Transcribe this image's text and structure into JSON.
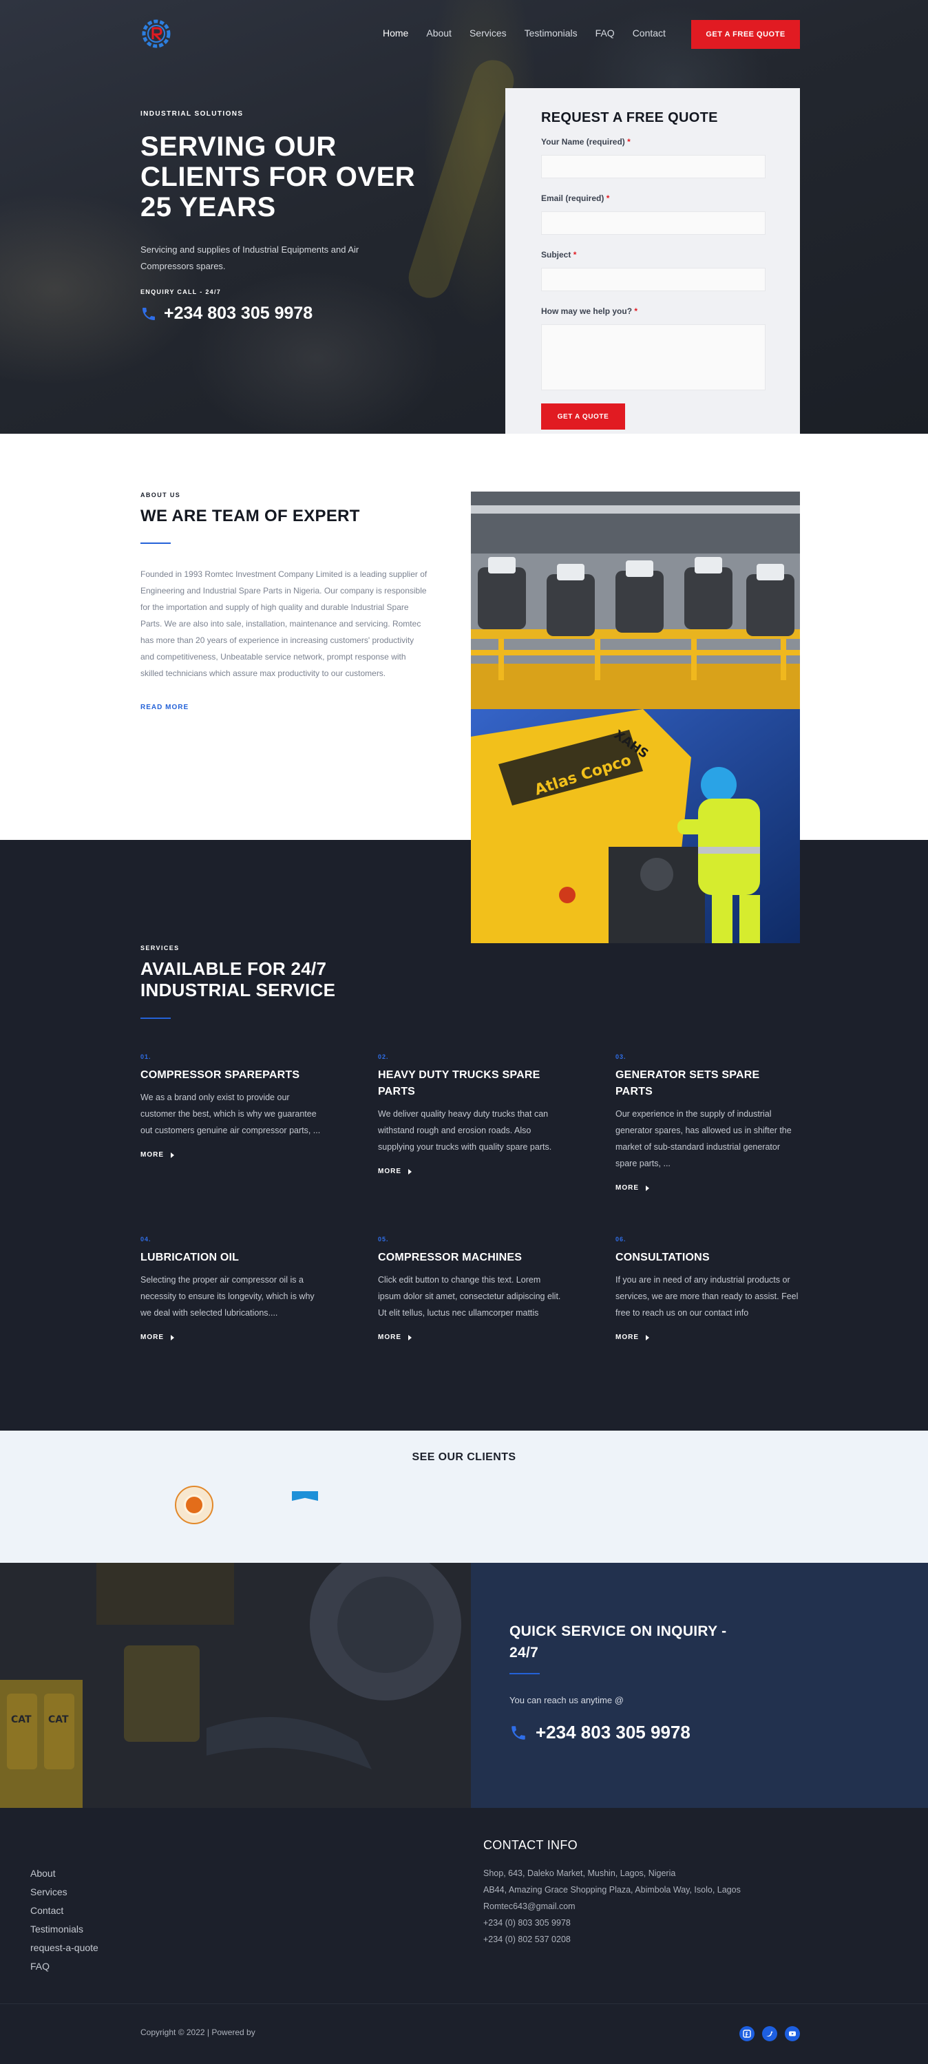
{
  "nav": {
    "items": [
      "Home",
      "About",
      "Services",
      "Testimonials",
      "FAQ",
      "Contact"
    ],
    "cta": "GET A FREE QUOTE"
  },
  "hero": {
    "eyebrow": "INDUSTRIAL SOLUTIONS",
    "title": "SERVING OUR CLIENTS FOR OVER 25 YEARS",
    "desc": "Servicing and supplies of Industrial Equipments and Air Compressors spares.",
    "enquiry_label": "ENQUIRY CALL - 24/7",
    "phone": "+234 803 305 9978"
  },
  "quote_form": {
    "title": "REQUEST A FREE QUOTE",
    "name_label": "Your Name (required)",
    "email_label": "Email (required)",
    "subject_label": "Subject",
    "message_label": "How may we help you?",
    "required_mark": "*",
    "submit": "GET A QUOTE"
  },
  "about": {
    "eyebrow": "ABOUT US",
    "title": "WE ARE TEAM OF EXPERT",
    "body": "Founded in 1993 Romtec Investment Company Limited is a leading supplier of Engineering and Industrial Spare Parts in Nigeria. Our company is responsible for the importation and supply of high quality and durable Industrial Spare Parts. We are also into sale, installation, maintenance and servicing.  Romtec has more than 20 years of experience in  increasing customers' productivity and competitiveness, Unbeatable service network, prompt response with skilled technicians which assure max productivity to our customers.",
    "read_more": "READ MORE",
    "image_text_1": "Atlas Copco",
    "image_text_2": "XAHS"
  },
  "services": {
    "eyebrow": "SERVICES",
    "title": "AVAILABLE FOR 24/7 INDUSTRIAL SERVICE",
    "more_label": "MORE",
    "items": [
      {
        "num": "01.",
        "title": "COMPRESSOR SPAREPARTS",
        "text": "We as a brand only exist to provide our customer the best, which is why we guarantee out customers genuine air compressor parts, ..."
      },
      {
        "num": "02.",
        "title": "HEAVY DUTY TRUCKS SPARE PARTS",
        "text": "We deliver quality heavy duty trucks that can withstand rough and erosion roads. Also supplying your trucks with quality spare parts."
      },
      {
        "num": "03.",
        "title": "GENERATOR SETS SPARE PARTS",
        "text": "Our experience in the supply of industrial generator spares, has allowed us in shifter the market of sub-standard industrial generator spare parts, ..."
      },
      {
        "num": "04.",
        "title": "LUBRICATION OIL",
        "text": "Selecting the proper air compressor oil is a necessity to ensure its longevity, which is why we deal with selected lubrications...."
      },
      {
        "num": "05.",
        "title": "COMPRESSOR MACHINES",
        "text": "Click edit button to change this text. Lorem ipsum dolor sit amet, consectetur adipiscing elit. Ut elit tellus, luctus nec ullamcorper mattis"
      },
      {
        "num": "06.",
        "title": "CONSULTATIONS",
        "text": "If you are in need of any industrial products or services, we are more than ready to assist. Feel free to reach us on our contact info"
      }
    ]
  },
  "clients": {
    "title": "SEE OUR CLIENTS"
  },
  "inquiry": {
    "title": "QUICK SERVICE ON INQUIRY - 24/7",
    "text": "You can reach us anytime @",
    "phone": "+234 803 305 9978",
    "image_text": "CAT"
  },
  "footer": {
    "links": [
      "About",
      "Services",
      "Contact",
      "Testimonials",
      "request-a-quote",
      "FAQ"
    ],
    "contact_title": "CONTACT INFO",
    "contact_lines": [
      "Shop, 643, Daleko Market, Mushin, Lagos, Nigeria",
      "AB44, Amazing Grace Shopping Plaza, Abimbola Way, Isolo, Lagos",
      "Romtec643@gmail.com",
      "+234 (0) 803 305 9978",
      "+234 (0) 802 537 0208"
    ],
    "copyright": "Copyright © 2022 | Powered by"
  },
  "colors": {
    "accent_red": "#e11b22",
    "accent_blue": "#2462d8",
    "dark_bg": "#1c202b",
    "navy": "#22314e"
  }
}
